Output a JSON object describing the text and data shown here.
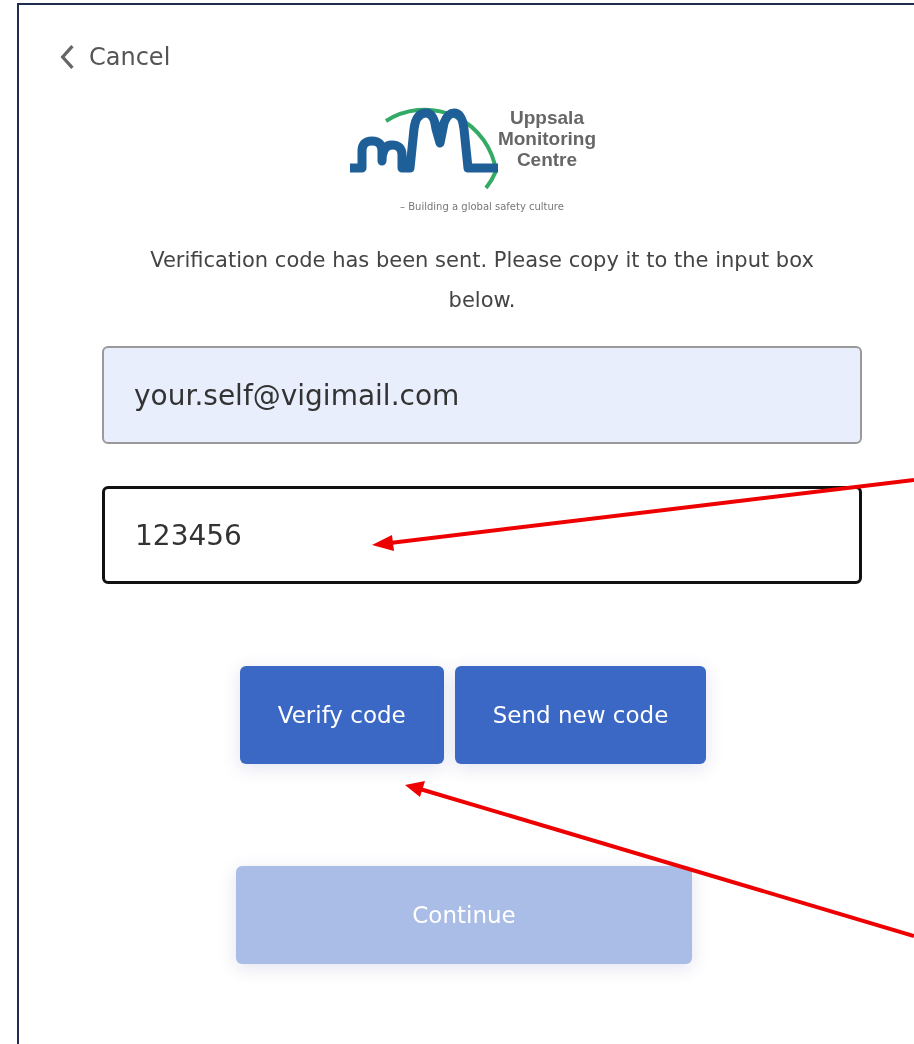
{
  "cancel_link": {
    "label": "Cancel"
  },
  "logo": {
    "name_lines": [
      "Uppsala",
      "Monitoring",
      "Centre"
    ],
    "tagline": "– Building a global safety culture"
  },
  "message": "Verification code has been sent. Please copy it to the input box below.",
  "fields": [
    {
      "value": "your.self@vigimail.com",
      "autofilled": true,
      "focused": false
    },
    {
      "value": "123456",
      "autofilled": false,
      "focused": true
    }
  ],
  "code_buttons": [
    {
      "label": "Verify code",
      "disabled": false
    },
    {
      "label": "Send new code",
      "disabled": false
    }
  ],
  "continue_button": {
    "label": "Continue",
    "disabled": true
  }
}
